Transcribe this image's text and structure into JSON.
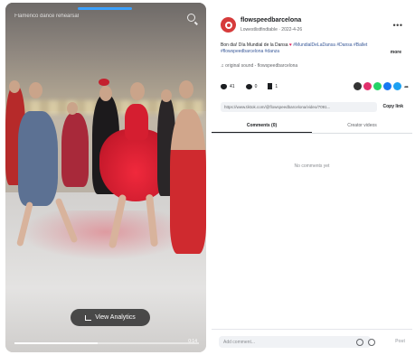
{
  "video": {
    "top_caption": "Flamenco dance rehearsal",
    "analytics_button": "View Analytics",
    "time": "0:14"
  },
  "post": {
    "account_name": "flowspeedbarcelona",
    "account_sub": "Lowestlistfindtable · 2022-4-26",
    "caption_lead": "Bon dia! Día Mundial de la Dansa",
    "caption_tags": "#MundialDeLaDansa #Dansa #Ballet #flowspeedbarcelona #danza",
    "more_label": "more",
    "meta": "original sound - flowspeedbarcelona",
    "likes": "41",
    "comments": "0",
    "saves": "1",
    "link": "https://www.tiktok.com/@flowspeedbarcelona/video/7091...",
    "copy_label": "Copy link",
    "tabs": [
      "Comments (0)",
      "Creator videos"
    ],
    "empty_text": "No comments yet",
    "comment_placeholder": "Add comment...",
    "post_label": "Post"
  },
  "colors": {
    "accent": "#d63b3b",
    "link": "#385898",
    "share_icons": [
      "#333333",
      "#e1306c",
      "#25d366",
      "#1877f2",
      "#1da1f2"
    ]
  }
}
